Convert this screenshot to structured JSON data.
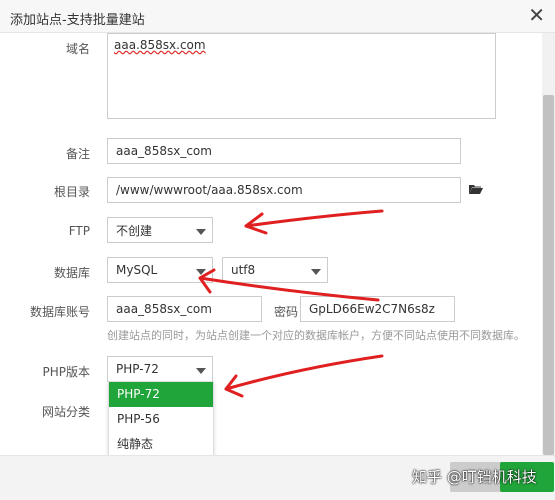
{
  "dialog": {
    "title": "添加站点-支持批量建站"
  },
  "form": {
    "domain": {
      "label": "域名",
      "value": "aaa.858sx.com"
    },
    "remark": {
      "label": "备注",
      "value": "aaa_858sx_com"
    },
    "root": {
      "label": "根目录",
      "value": "/www/wwwroot/aaa.858sx.com"
    },
    "ftp": {
      "label": "FTP",
      "value": "不创建"
    },
    "database": {
      "label": "数据库",
      "type": "MySQL",
      "charset": "utf8"
    },
    "db_account": {
      "label": "数据库账号",
      "value": "aaa_858sx_com",
      "password_label": "密码",
      "password": "GpLD66Ew2C7N6s8z"
    },
    "hint": "创建站点的同时，为站点创建一个对应的数据库帐户，方便不同站点使用不同数据库。",
    "php": {
      "label": "PHP版本",
      "value": "PHP-72",
      "options": [
        "PHP-72",
        "PHP-56",
        "纯静态"
      ]
    },
    "category": {
      "label": "网站分类"
    }
  },
  "footer": {
    "watermark": "知乎 @叮铛机科技",
    "cancel_label": "",
    "submit_label": ""
  },
  "colors": {
    "accent": "#20a53a",
    "arrow": "#e02020"
  }
}
